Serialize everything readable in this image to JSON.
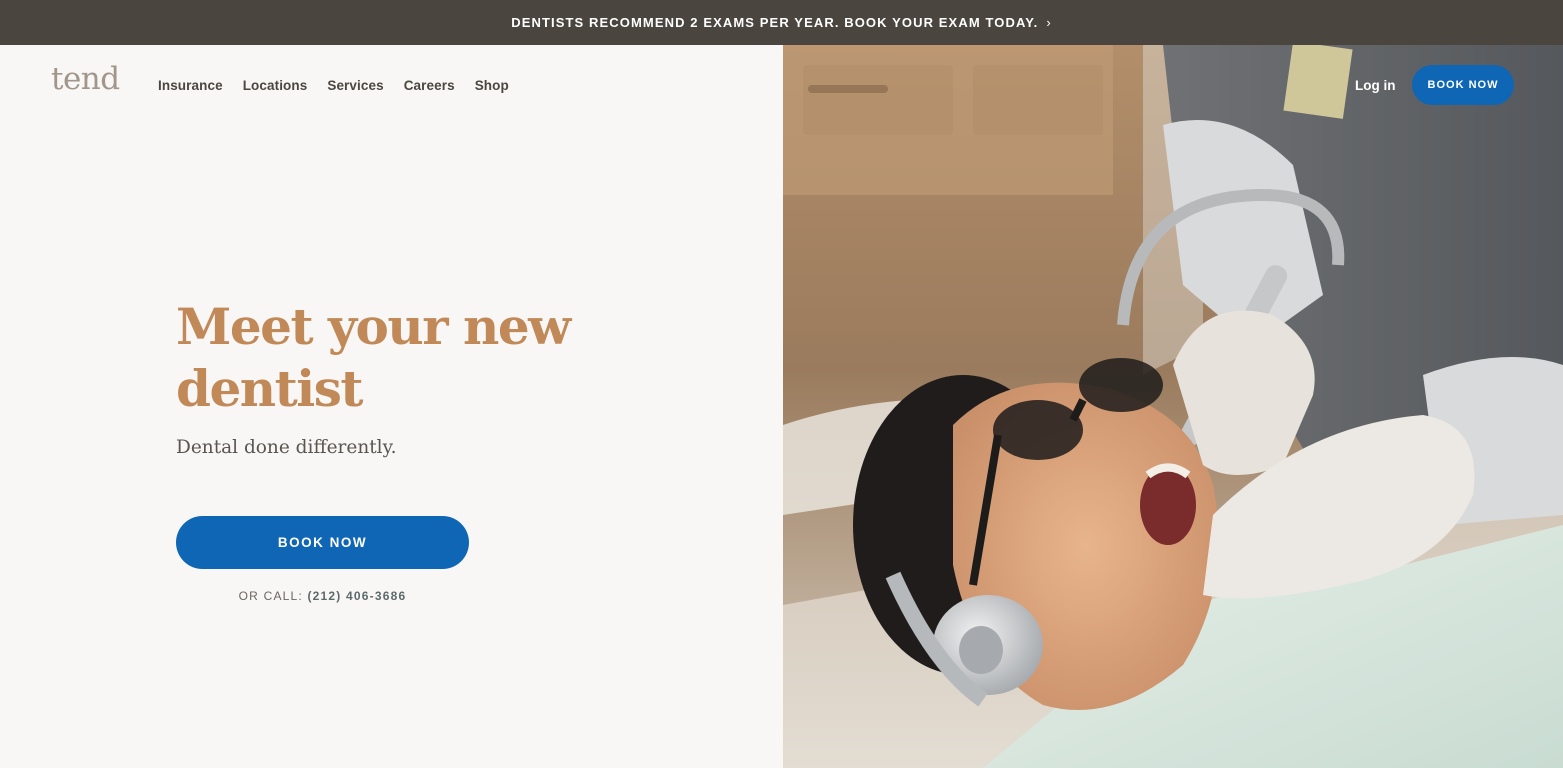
{
  "promo": {
    "text": "DENTISTS RECOMMEND 2 EXAMS PER YEAR. BOOK YOUR EXAM TODAY.",
    "icon": "chevron-right-icon",
    "background": "#4a453f"
  },
  "header": {
    "logo": "tend",
    "nav": [
      "Insurance",
      "Locations",
      "Services",
      "Careers",
      "Shop"
    ],
    "login": "Log in",
    "book_label": "BOOK NOW"
  },
  "hero": {
    "title": "Meet your new dentist",
    "subtitle": "Dental done differently.",
    "cta_label": "BOOK NOW",
    "call_prefix": "OR CALL:",
    "phone": "(212) 406-3686"
  },
  "colors": {
    "accent": "#0f66b4",
    "title": "#c08957",
    "background": "#f8f7f5"
  }
}
